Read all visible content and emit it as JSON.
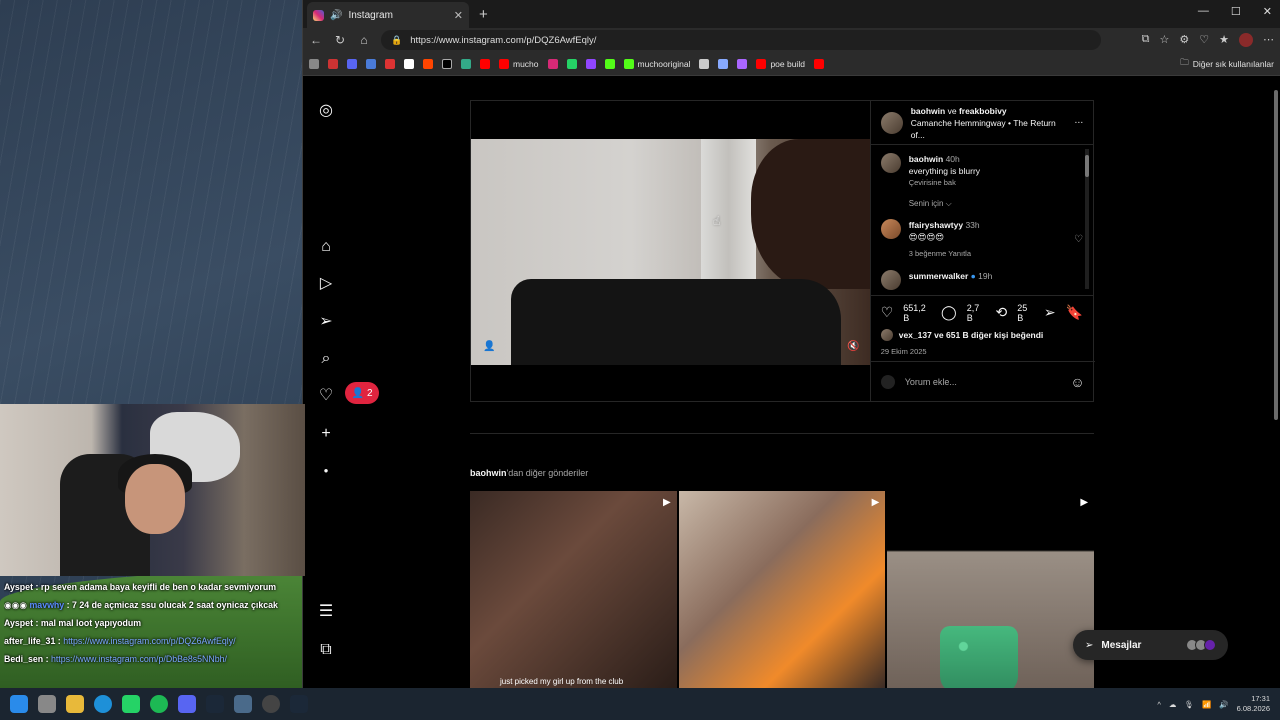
{
  "browser": {
    "tab_title": "Instagram",
    "url": "https://www.instagram.com/p/DQZ6AwfEqly/",
    "bookmarks": [
      "mucho",
      "muchooriginal",
      "poe build"
    ],
    "other_bookmarks": "Diğer sık kullanılanlar"
  },
  "instagram": {
    "notification_count": "2",
    "post": {
      "header_user": "baohwin",
      "header_connector": "ve",
      "header_user2": "freakbobivy",
      "header_audio": "Camanche Hemmingway • The Return of...",
      "comments": [
        {
          "user": "baohwin",
          "time": "40h",
          "text": "everything is blurry",
          "sub": "Çevirisine bak"
        },
        {
          "user": "ffairyshawtyy",
          "time": "33h",
          "text": "😍😍😍😍",
          "sub": "3 beğenme   Yanıtla"
        },
        {
          "user": "summerwalker",
          "time": "19h",
          "text": "",
          "sub": ""
        }
      ],
      "for_you": "Senin için ⌵",
      "likes": "651,2 B",
      "comments_count": "2,7 B",
      "reposts": "25 B",
      "liked_by": "vex_137 ve 651 B diğer kişi beğendi",
      "date": "29 Ekim 2025",
      "add_comment_placeholder": "Yorum ekle..."
    },
    "more_posts": {
      "user": "baohwin",
      "suffix": "'dan diğer gönderiler"
    },
    "tile1_caption": "just picked my girl up from the club",
    "messages_label": "Mesajlar"
  },
  "chat": [
    {
      "user": "Ayspet",
      "text": " : rp seven adama baya keyifli de ben o kadar sevmiyorum"
    },
    {
      "user": "mavwhy",
      "text": " : 7 24 de açmicaz ssu olucak 2 saat oynicaz çıkcak"
    },
    {
      "user": "Ayspet",
      "text": " : mal mal loot yapıyodum"
    },
    {
      "user": "after_life_31",
      "text": " : ",
      "link": "https://www.instagram.com/p/DQZ6AwfEqly/"
    },
    {
      "user": "Bedi_sen",
      "text": " : ",
      "link": "https://www.instagram.com/p/DbBe8s5NNbh/"
    }
  ],
  "taskbar": {
    "time": "17:31",
    "date": "6.08.2026"
  }
}
